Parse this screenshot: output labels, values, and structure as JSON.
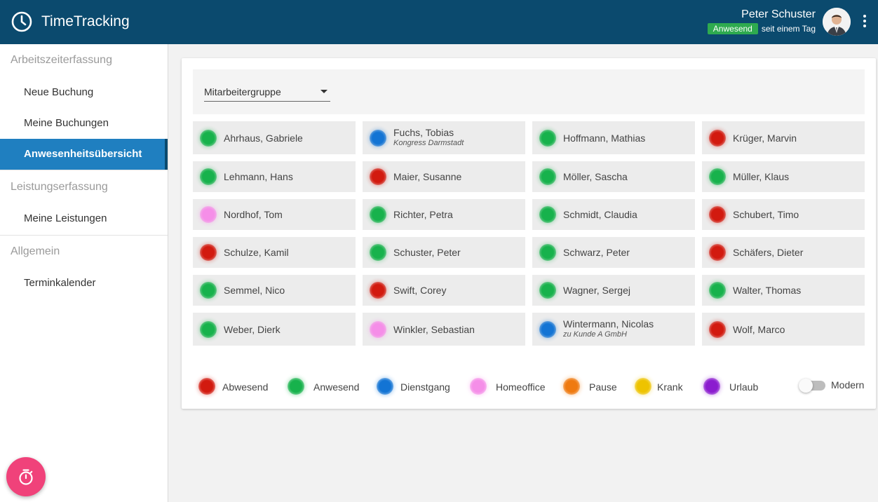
{
  "app": {
    "title": "TimeTracking"
  },
  "user": {
    "name": "Peter Schuster",
    "status": "Anwesend",
    "status_since": "seit einem Tag"
  },
  "sidebar": {
    "sections": [
      {
        "heading": "Arbeitszeiterfassung",
        "items": [
          "Neue Buchung",
          "Meine Buchungen",
          "Anwesenheitsübersicht"
        ]
      },
      {
        "heading": "Leistungserfassung",
        "items": [
          "Meine Leistungen"
        ]
      },
      {
        "heading": "Allgemein",
        "items": [
          "Terminkalender"
        ]
      }
    ],
    "active_item": "Anwesenheitsübersicht"
  },
  "filter": {
    "label": "Mitarbeitergruppe"
  },
  "colors": {
    "header": "#0b4a6e",
    "active_nav": "#1f7fc0",
    "fab": "#f0427a",
    "Abwesend": "#d21a0f",
    "Anwesend": "#17b24c",
    "Dienstgang": "#1374d4",
    "Homeoffice": "#f58ee8",
    "Pause": "#ef7a10",
    "Krank": "#eec300",
    "Urlaub": "#8b1ccf"
  },
  "employees": [
    {
      "name": "Ahrhaus, Gabriele",
      "status": "Anwesend"
    },
    {
      "name": "Fuchs, Tobias",
      "status": "Dienstgang",
      "note": "Kongress Darmstadt"
    },
    {
      "name": "Hoffmann, Mathias",
      "status": "Anwesend"
    },
    {
      "name": "Krüger, Marvin",
      "status": "Abwesend"
    },
    {
      "name": "Lehmann, Hans",
      "status": "Anwesend"
    },
    {
      "name": "Maier, Susanne",
      "status": "Abwesend"
    },
    {
      "name": "Möller, Sascha",
      "status": "Anwesend"
    },
    {
      "name": "Müller, Klaus",
      "status": "Anwesend"
    },
    {
      "name": "Nordhof, Tom",
      "status": "Homeoffice"
    },
    {
      "name": "Richter, Petra",
      "status": "Anwesend"
    },
    {
      "name": "Schmidt, Claudia",
      "status": "Anwesend"
    },
    {
      "name": "Schubert, Timo",
      "status": "Abwesend"
    },
    {
      "name": "Schulze, Kamil",
      "status": "Abwesend"
    },
    {
      "name": "Schuster, Peter",
      "status": "Anwesend"
    },
    {
      "name": "Schwarz, Peter",
      "status": "Anwesend"
    },
    {
      "name": "Schäfers, Dieter",
      "status": "Abwesend"
    },
    {
      "name": "Semmel, Nico",
      "status": "Anwesend"
    },
    {
      "name": "Swift, Corey",
      "status": "Abwesend"
    },
    {
      "name": "Wagner, Sergej",
      "status": "Anwesend"
    },
    {
      "name": "Walter, Thomas",
      "status": "Anwesend"
    },
    {
      "name": "Weber, Dierk",
      "status": "Anwesend"
    },
    {
      "name": "Winkler, Sebastian",
      "status": "Homeoffice"
    },
    {
      "name": "Wintermann, Nicolas",
      "status": "Dienstgang",
      "note": "zu Kunde A GmbH"
    },
    {
      "name": "Wolf, Marco",
      "status": "Abwesend"
    }
  ],
  "legend": [
    "Abwesend",
    "Anwesend",
    "Dienstgang",
    "Homeoffice",
    "Pause",
    "Krank",
    "Urlaub"
  ],
  "toggle": {
    "label": "Modern",
    "on": false
  },
  "icons": {
    "logo": "clock-icon",
    "menu": "more-vert-icon",
    "fab": "stopwatch-icon"
  }
}
